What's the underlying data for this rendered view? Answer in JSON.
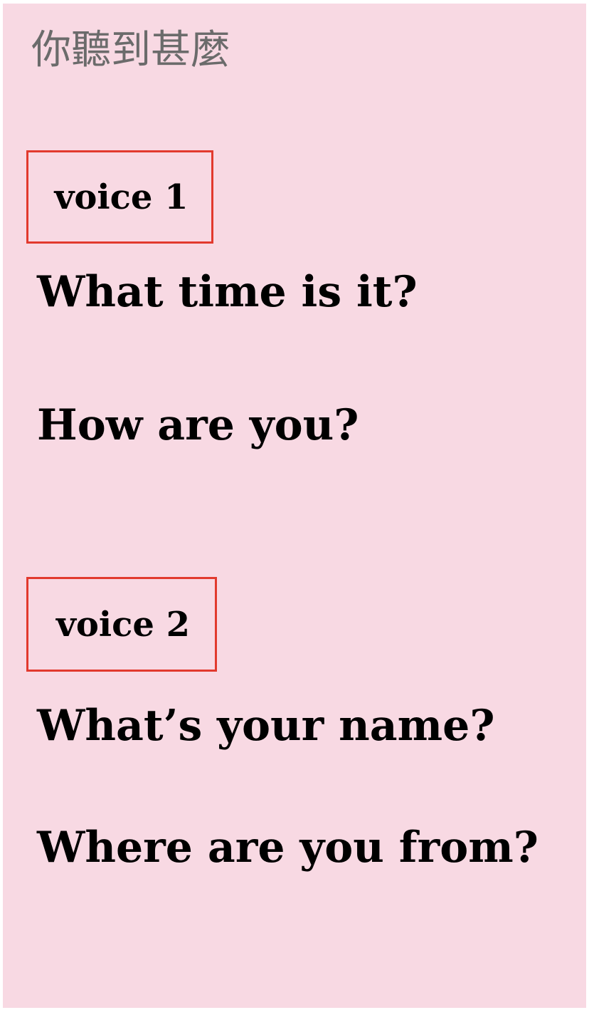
{
  "header": {
    "title": "你聽到甚麼"
  },
  "voice1": {
    "label": "voice 1",
    "phrases": [
      "What time is it?",
      "How are you?"
    ]
  },
  "voice2": {
    "label": "voice 2",
    "phrases": [
      "What’s your name?",
      "Where are you from?"
    ]
  },
  "colors": {
    "background": "#f8d9e3",
    "box_border": "#e23a2e",
    "header_text": "#6b6b6b",
    "phrase_text": "#000000"
  }
}
